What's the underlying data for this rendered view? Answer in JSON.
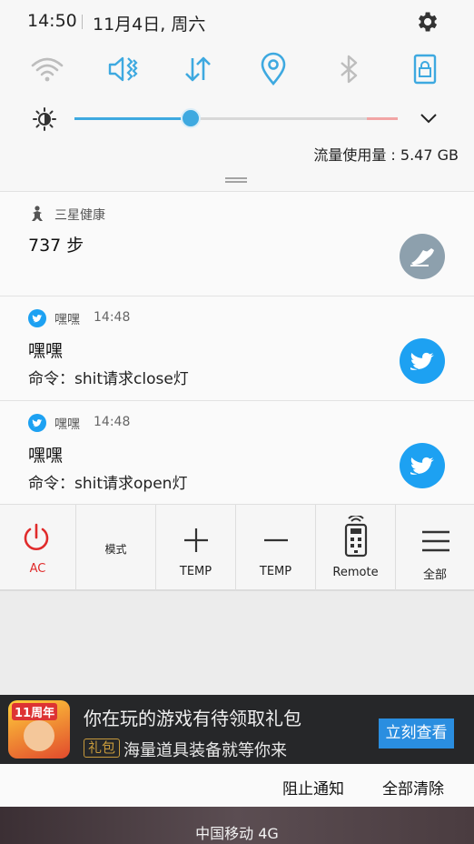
{
  "quick_settings": {
    "time": "14:50",
    "date": "11月4日, 周六",
    "tiles": [
      "wifi-icon",
      "vibrate-icon",
      "mobile-data-icon",
      "location-icon",
      "bluetooth-icon",
      "screen-lock-icon"
    ],
    "brightness_level": 0.36,
    "data_usage": "流量使用量 : 5.47 GB"
  },
  "notifications": [
    {
      "app": "三星健康",
      "time": "",
      "title": "737 步",
      "body": ""
    },
    {
      "app": "嘿嘿",
      "time": "14:48",
      "title": "嘿嘿",
      "body": "命令：shit请求close灯"
    },
    {
      "app": "嘿嘿",
      "time": "14:48",
      "title": "嘿嘿",
      "body": "命令：shit请求open灯"
    }
  ],
  "remote": {
    "ac_label": "AC",
    "mode_label": "模式",
    "temp_up_label": "TEMP",
    "temp_down_label": "TEMP",
    "remote_label": "Remote",
    "all_label": "全部"
  },
  "game_notice": {
    "logo_text": "11周年",
    "title": "你在玩的游戏有待领取礼包",
    "tag": "礼包",
    "subtitle": "海量道具装备就等你来",
    "button": "立刻查看"
  },
  "actions": {
    "block": "阻止通知",
    "clear_all": "全部清除"
  },
  "status_bar": {
    "carrier": "中国移动 4G"
  },
  "colors": {
    "accent": "#3ea9e0",
    "twitter": "#1da1f2",
    "power_red": "#e02b2b",
    "health_badge": "#8da0ad",
    "game_button": "#2a8ee0"
  }
}
